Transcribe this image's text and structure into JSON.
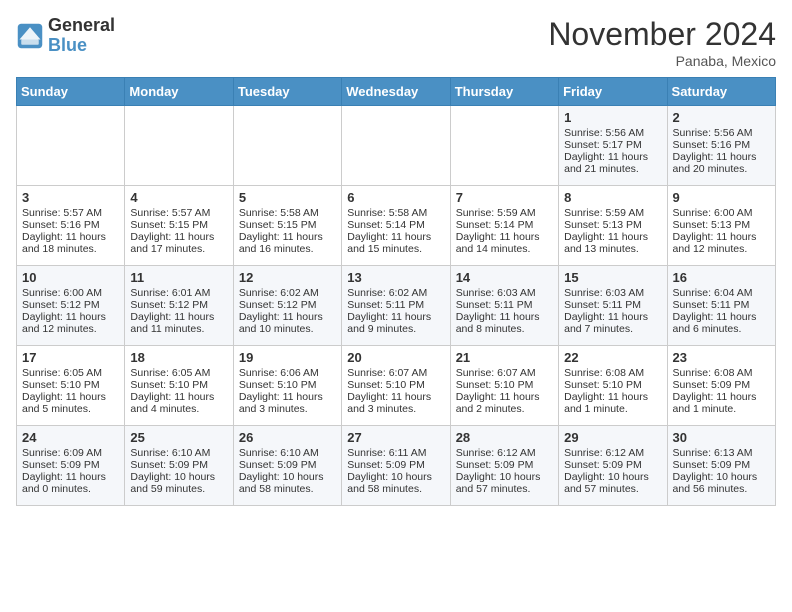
{
  "header": {
    "logo_line1": "General",
    "logo_line2": "Blue",
    "month": "November 2024",
    "location": "Panaba, Mexico"
  },
  "weekdays": [
    "Sunday",
    "Monday",
    "Tuesday",
    "Wednesday",
    "Thursday",
    "Friday",
    "Saturday"
  ],
  "weeks": [
    [
      {
        "day": "",
        "info": ""
      },
      {
        "day": "",
        "info": ""
      },
      {
        "day": "",
        "info": ""
      },
      {
        "day": "",
        "info": ""
      },
      {
        "day": "",
        "info": ""
      },
      {
        "day": "1",
        "info": "Sunrise: 5:56 AM\nSunset: 5:17 PM\nDaylight: 11 hours\nand 21 minutes."
      },
      {
        "day": "2",
        "info": "Sunrise: 5:56 AM\nSunset: 5:16 PM\nDaylight: 11 hours\nand 20 minutes."
      }
    ],
    [
      {
        "day": "3",
        "info": "Sunrise: 5:57 AM\nSunset: 5:16 PM\nDaylight: 11 hours\nand 18 minutes."
      },
      {
        "day": "4",
        "info": "Sunrise: 5:57 AM\nSunset: 5:15 PM\nDaylight: 11 hours\nand 17 minutes."
      },
      {
        "day": "5",
        "info": "Sunrise: 5:58 AM\nSunset: 5:15 PM\nDaylight: 11 hours\nand 16 minutes."
      },
      {
        "day": "6",
        "info": "Sunrise: 5:58 AM\nSunset: 5:14 PM\nDaylight: 11 hours\nand 15 minutes."
      },
      {
        "day": "7",
        "info": "Sunrise: 5:59 AM\nSunset: 5:14 PM\nDaylight: 11 hours\nand 14 minutes."
      },
      {
        "day": "8",
        "info": "Sunrise: 5:59 AM\nSunset: 5:13 PM\nDaylight: 11 hours\nand 13 minutes."
      },
      {
        "day": "9",
        "info": "Sunrise: 6:00 AM\nSunset: 5:13 PM\nDaylight: 11 hours\nand 12 minutes."
      }
    ],
    [
      {
        "day": "10",
        "info": "Sunrise: 6:00 AM\nSunset: 5:12 PM\nDaylight: 11 hours\nand 12 minutes."
      },
      {
        "day": "11",
        "info": "Sunrise: 6:01 AM\nSunset: 5:12 PM\nDaylight: 11 hours\nand 11 minutes."
      },
      {
        "day": "12",
        "info": "Sunrise: 6:02 AM\nSunset: 5:12 PM\nDaylight: 11 hours\nand 10 minutes."
      },
      {
        "day": "13",
        "info": "Sunrise: 6:02 AM\nSunset: 5:11 PM\nDaylight: 11 hours\nand 9 minutes."
      },
      {
        "day": "14",
        "info": "Sunrise: 6:03 AM\nSunset: 5:11 PM\nDaylight: 11 hours\nand 8 minutes."
      },
      {
        "day": "15",
        "info": "Sunrise: 6:03 AM\nSunset: 5:11 PM\nDaylight: 11 hours\nand 7 minutes."
      },
      {
        "day": "16",
        "info": "Sunrise: 6:04 AM\nSunset: 5:11 PM\nDaylight: 11 hours\nand 6 minutes."
      }
    ],
    [
      {
        "day": "17",
        "info": "Sunrise: 6:05 AM\nSunset: 5:10 PM\nDaylight: 11 hours\nand 5 minutes."
      },
      {
        "day": "18",
        "info": "Sunrise: 6:05 AM\nSunset: 5:10 PM\nDaylight: 11 hours\nand 4 minutes."
      },
      {
        "day": "19",
        "info": "Sunrise: 6:06 AM\nSunset: 5:10 PM\nDaylight: 11 hours\nand 3 minutes."
      },
      {
        "day": "20",
        "info": "Sunrise: 6:07 AM\nSunset: 5:10 PM\nDaylight: 11 hours\nand 3 minutes."
      },
      {
        "day": "21",
        "info": "Sunrise: 6:07 AM\nSunset: 5:10 PM\nDaylight: 11 hours\nand 2 minutes."
      },
      {
        "day": "22",
        "info": "Sunrise: 6:08 AM\nSunset: 5:10 PM\nDaylight: 11 hours\nand 1 minute."
      },
      {
        "day": "23",
        "info": "Sunrise: 6:08 AM\nSunset: 5:09 PM\nDaylight: 11 hours\nand 1 minute."
      }
    ],
    [
      {
        "day": "24",
        "info": "Sunrise: 6:09 AM\nSunset: 5:09 PM\nDaylight: 11 hours\nand 0 minutes."
      },
      {
        "day": "25",
        "info": "Sunrise: 6:10 AM\nSunset: 5:09 PM\nDaylight: 10 hours\nand 59 minutes."
      },
      {
        "day": "26",
        "info": "Sunrise: 6:10 AM\nSunset: 5:09 PM\nDaylight: 10 hours\nand 58 minutes."
      },
      {
        "day": "27",
        "info": "Sunrise: 6:11 AM\nSunset: 5:09 PM\nDaylight: 10 hours\nand 58 minutes."
      },
      {
        "day": "28",
        "info": "Sunrise: 6:12 AM\nSunset: 5:09 PM\nDaylight: 10 hours\nand 57 minutes."
      },
      {
        "day": "29",
        "info": "Sunrise: 6:12 AM\nSunset: 5:09 PM\nDaylight: 10 hours\nand 57 minutes."
      },
      {
        "day": "30",
        "info": "Sunrise: 6:13 AM\nSunset: 5:09 PM\nDaylight: 10 hours\nand 56 minutes."
      }
    ]
  ]
}
